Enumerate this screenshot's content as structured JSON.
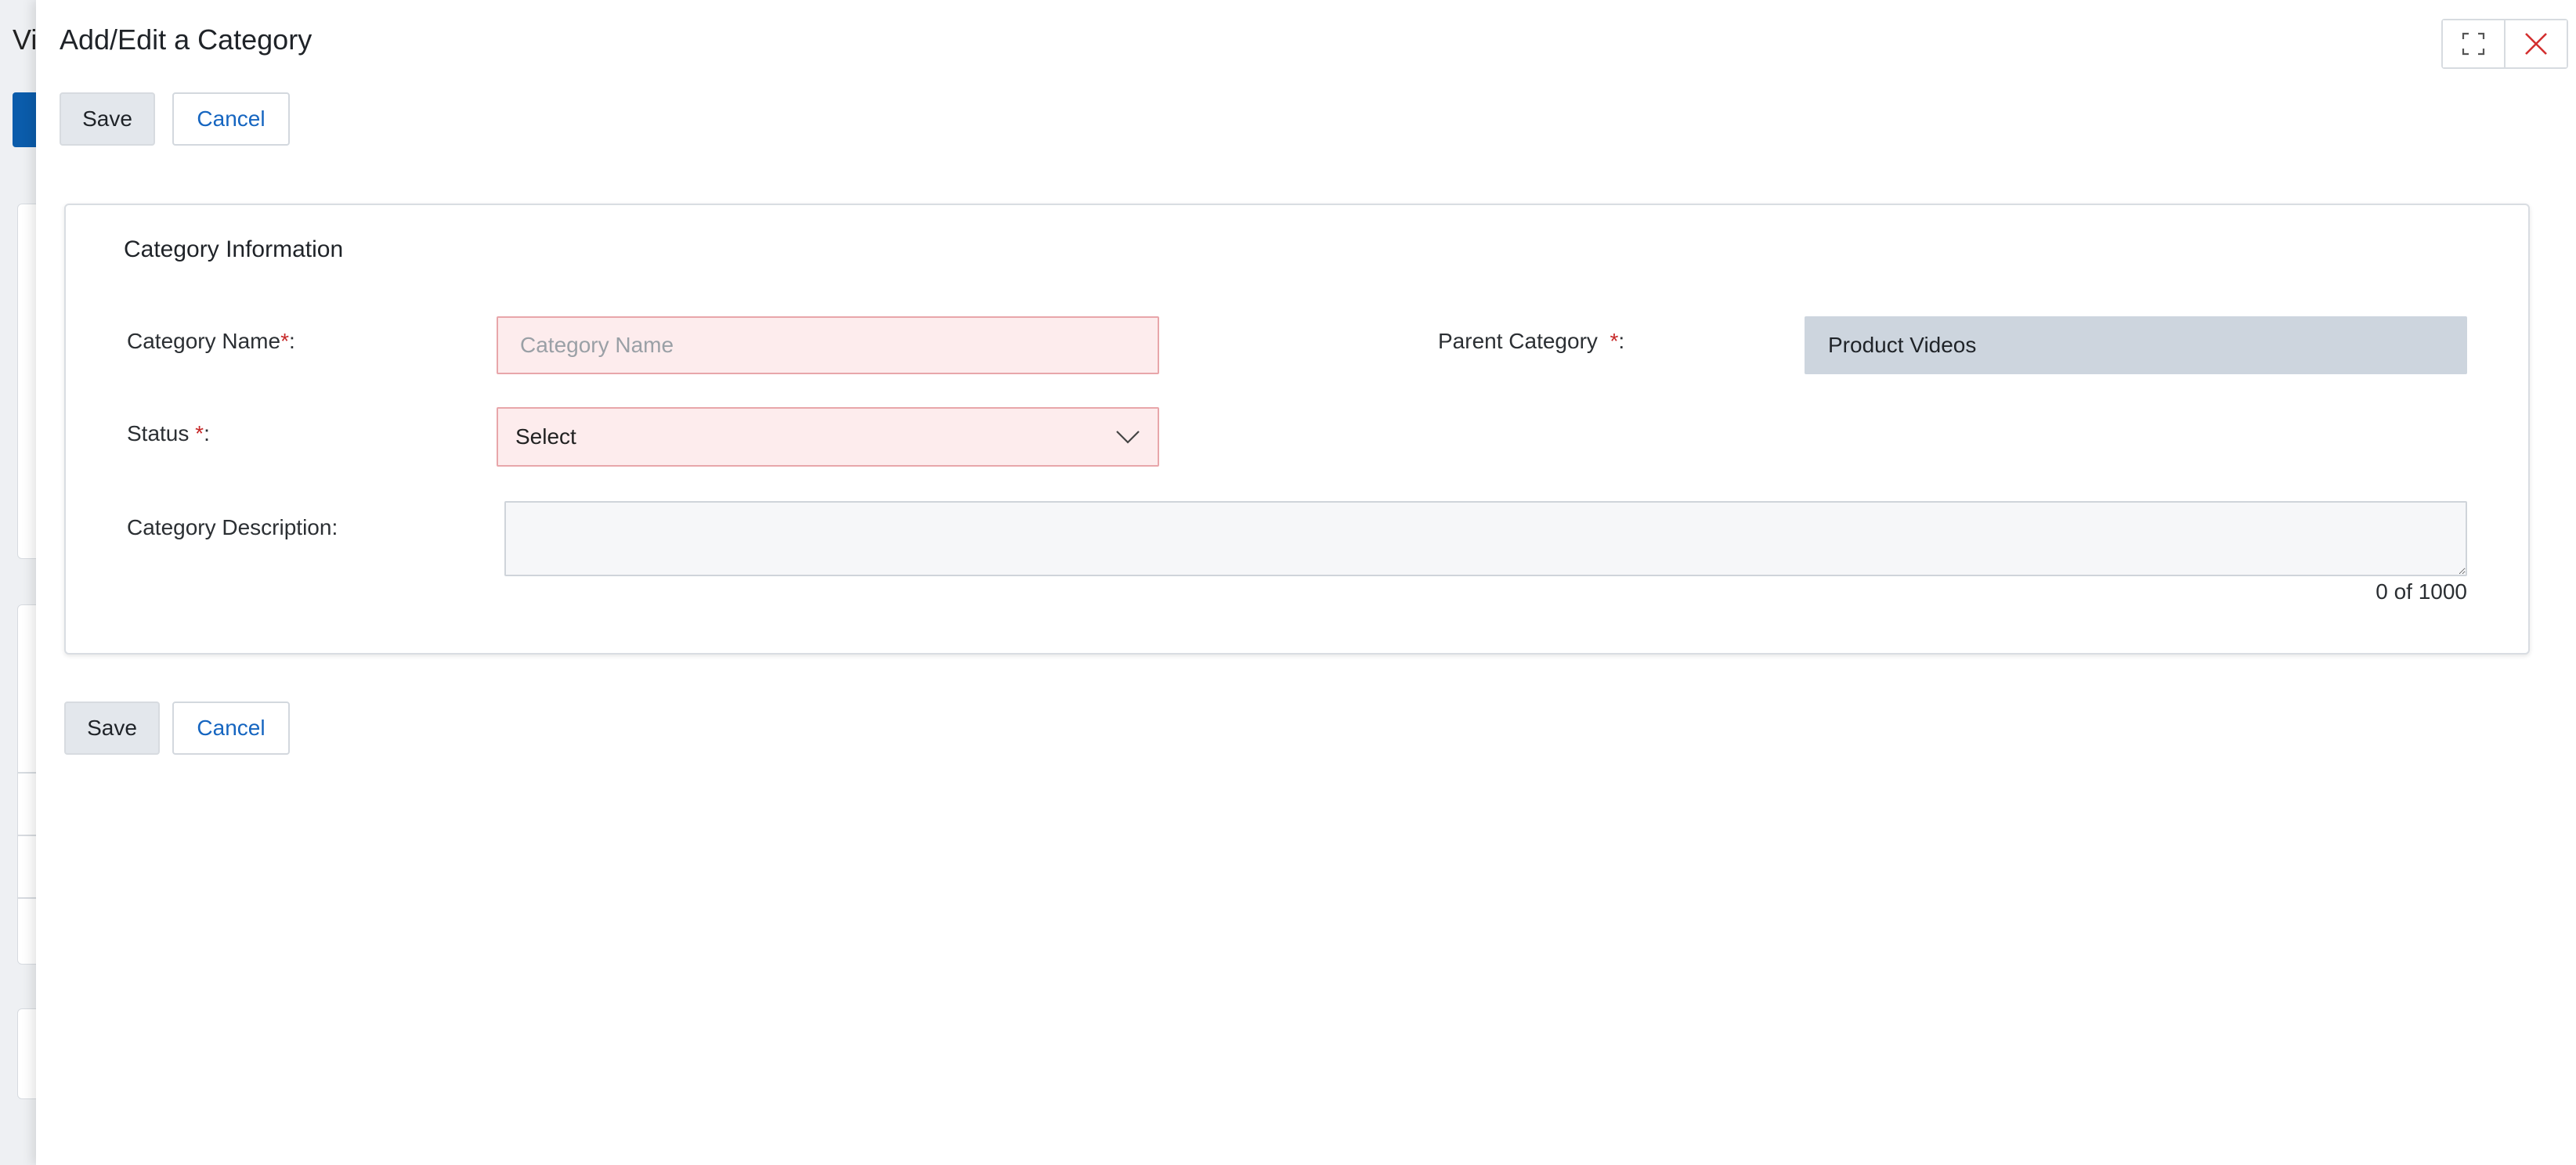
{
  "background": {
    "title_fragment": "Vi"
  },
  "modal": {
    "title": "Add/Edit a Category",
    "controls": {
      "maximize_icon": "expand-icon",
      "close_icon": "close-icon",
      "close_color": "#d32f2f"
    },
    "top_actions": {
      "save": "Save",
      "cancel": "Cancel"
    },
    "bottom_actions": {
      "save": "Save",
      "cancel": "Cancel"
    },
    "section": {
      "title": "Category Information",
      "category_name": {
        "label": "Category Name",
        "required_mark": "*",
        "suffix": ":",
        "value": "",
        "placeholder": "Category Name"
      },
      "parent_category": {
        "label": "Parent Category",
        "required_mark": "*",
        "suffix": ":",
        "value": "Product Videos"
      },
      "status": {
        "label": "Status",
        "required_mark": "*",
        "suffix": ":",
        "selected": "Select"
      },
      "description": {
        "label": "Category Description:",
        "value": "",
        "counter": "0 of 1000"
      }
    }
  },
  "colors": {
    "accent": "#1565c0",
    "error_bg": "#fdeced",
    "error_border": "#e8a6aa",
    "readonly_bg": "#cdd5de",
    "required": "#c62828"
  }
}
